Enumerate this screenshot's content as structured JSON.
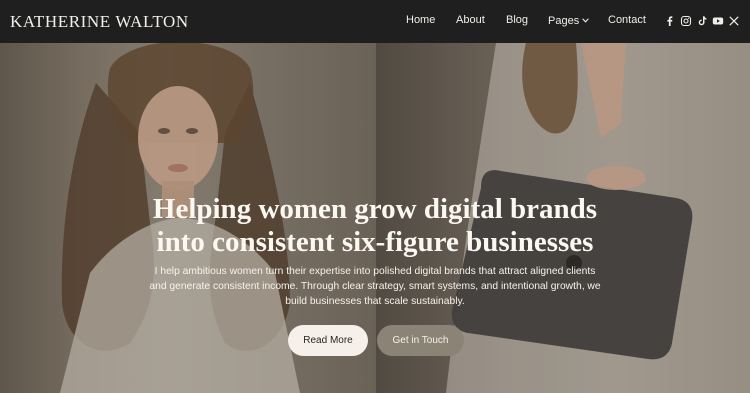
{
  "header": {
    "brand": "KATHERINE WALTON",
    "nav": [
      {
        "label": "Home"
      },
      {
        "label": "About"
      },
      {
        "label": "Blog"
      },
      {
        "label": "Pages"
      },
      {
        "label": "Contact"
      }
    ],
    "socials": [
      "facebook-icon",
      "instagram-icon",
      "tiktok-icon",
      "youtube-icon",
      "x-icon"
    ]
  },
  "hero": {
    "headline_line1": "Helping women grow digital brands",
    "headline_line2": "into consistent six-figure businesses",
    "body_line1": "I help ambitious women turn their expertise into polished digital brands that attract aligned clients",
    "body_line2": "and generate consistent income. Through clear strategy, smart systems, and intentional growth, we",
    "body_line3": "build businesses that scale sustainably.",
    "primary_button": "Read More",
    "secondary_button": "Get in Touch"
  },
  "colors": {
    "header_bg": "#1f1f1f",
    "text_light": "#f3f0ea",
    "primary_button_bg": "#f5f1ea",
    "secondary_button_bg": "#8c8377"
  }
}
